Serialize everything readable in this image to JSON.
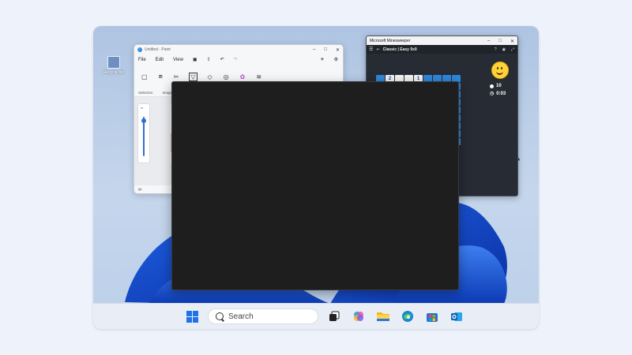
{
  "desktop": {
    "recycle_bin_label": "Recycle Bin"
  },
  "paint": {
    "title": "Untitled - Paint",
    "menu": [
      "File",
      "Edit",
      "View"
    ],
    "ribbon_labels": [
      "Selection",
      "Image"
    ],
    "controls": {
      "minimize": "–",
      "maximize": "□",
      "close": "✕"
    }
  },
  "minesweeper": {
    "title": "Microsoft Minesweeper",
    "mode": "Classic | Easy 9x9",
    "mines_count": "10",
    "timer": "0:03",
    "board_row1": [
      "",
      "2",
      "",
      "",
      "1",
      "",
      "",
      "",
      ""
    ],
    "controls": {
      "minimize": "–",
      "maximize": "□",
      "close": "✕"
    }
  },
  "taskbar": {
    "search_placeholder": "Search"
  },
  "colors": {
    "accent": "#1e74e6",
    "tile_blue": "#2f86d8",
    "dark_window": "#1e1e1e"
  }
}
